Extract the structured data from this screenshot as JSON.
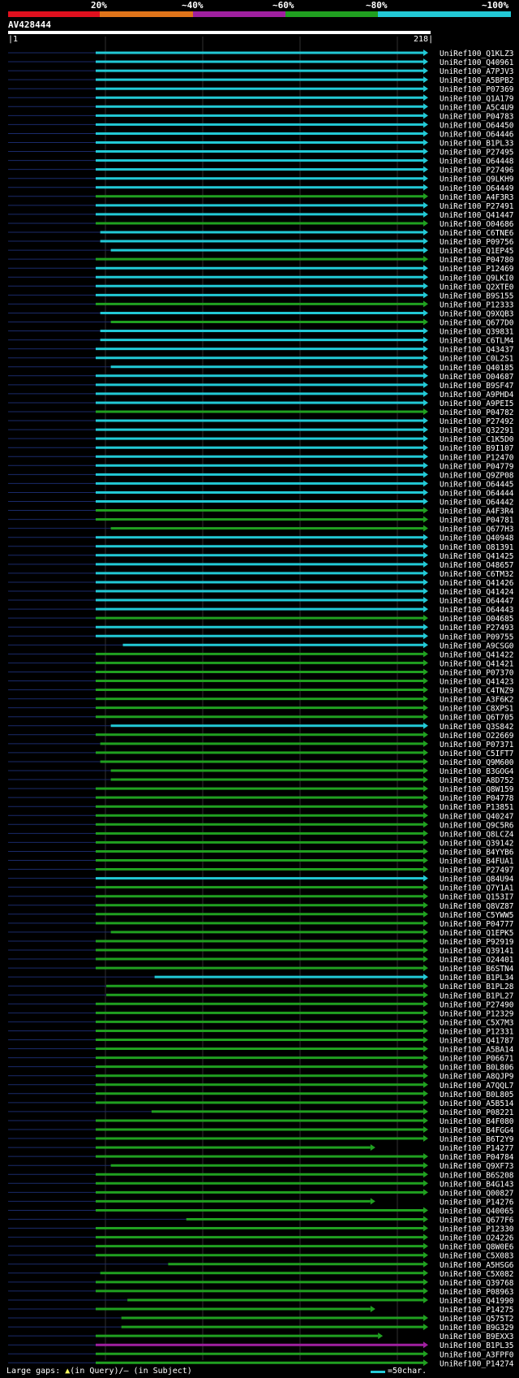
{
  "chart_data": {
    "type": "alignment-overview",
    "query": {
      "name": "AV428444",
      "start_label": "1",
      "end_label": "218",
      "length": 218
    },
    "percent_legend": [
      {
        "label": "20%",
        "color": "#e0101e"
      },
      {
        "label": "~40%",
        "color": "#e0741a"
      },
      {
        "label": "~60%",
        "color": "#a020a0"
      },
      {
        "label": "~80%",
        "color": "#20a020"
      },
      {
        "label": "~100%",
        "color": "#22c9d6"
      }
    ],
    "footer": {
      "large_gaps": "Large gaps: ",
      "in_query": "(in Query)/",
      "in_subject": "– (in Subject)",
      "scale": "=50char."
    },
    "hits": [
      {
        "id": "UniRef100_Q1KLZ3",
        "start": 1,
        "end": 218,
        "identity": "~100%"
      },
      {
        "id": "UniRef100_Q40961",
        "start": 1,
        "end": 218,
        "identity": "~100%"
      },
      {
        "id": "UniRef100_A7PJV3",
        "start": 1,
        "end": 218,
        "identity": "~100%"
      },
      {
        "id": "UniRef100_A5BPB2",
        "start": 1,
        "end": 218,
        "identity": "~100%"
      },
      {
        "id": "UniRef100_P07369",
        "start": 1,
        "end": 218,
        "identity": "~100%"
      },
      {
        "id": "UniRef100_Q1A179",
        "start": 1,
        "end": 218,
        "identity": "~100%"
      },
      {
        "id": "UniRef100_A5C4U9",
        "start": 1,
        "end": 218,
        "identity": "~100%"
      },
      {
        "id": "UniRef100_P04783",
        "start": 1,
        "end": 218,
        "identity": "~100%"
      },
      {
        "id": "UniRef100_O64450",
        "start": 1,
        "end": 218,
        "identity": "~100%"
      },
      {
        "id": "UniRef100_O64446",
        "start": 1,
        "end": 218,
        "identity": "~100%"
      },
      {
        "id": "UniRef100_B1PL33",
        "start": 1,
        "end": 218,
        "identity": "~100%"
      },
      {
        "id": "UniRef100_P27495",
        "start": 1,
        "end": 218,
        "identity": "~100%"
      },
      {
        "id": "UniRef100_O64448",
        "start": 1,
        "end": 218,
        "identity": "~100%"
      },
      {
        "id": "UniRef100_P27496",
        "start": 1,
        "end": 218,
        "identity": "~100%"
      },
      {
        "id": "UniRef100_Q9LKH9",
        "start": 1,
        "end": 218,
        "identity": "~100%"
      },
      {
        "id": "UniRef100_O64449",
        "start": 1,
        "end": 218,
        "identity": "~100%"
      },
      {
        "id": "UniRef100_A4F3R3",
        "start": 1,
        "end": 218,
        "identity": "~80%"
      },
      {
        "id": "UniRef100_P27491",
        "start": 1,
        "end": 218,
        "identity": "~100%"
      },
      {
        "id": "UniRef100_Q41447",
        "start": 1,
        "end": 218,
        "identity": "~100%"
      },
      {
        "id": "UniRef100_O04686",
        "start": 1,
        "end": 218,
        "identity": "~80%"
      },
      {
        "id": "UniRef100_C6TNE6",
        "start": 4,
        "end": 218,
        "identity": "~100%"
      },
      {
        "id": "UniRef100_P09756",
        "start": 4,
        "end": 218,
        "identity": "~100%"
      },
      {
        "id": "UniRef100_Q1EP45",
        "start": 11,
        "end": 218,
        "identity": "~100%"
      },
      {
        "id": "UniRef100_P04780",
        "start": 1,
        "end": 218,
        "identity": "~80%"
      },
      {
        "id": "UniRef100_P12469",
        "start": 1,
        "end": 218,
        "identity": "~100%"
      },
      {
        "id": "UniRef100_Q9LKI0",
        "start": 1,
        "end": 218,
        "identity": "~100%"
      },
      {
        "id": "UniRef100_Q2XTE0",
        "start": 1,
        "end": 218,
        "identity": "~100%"
      },
      {
        "id": "UniRef100_B9S155",
        "start": 1,
        "end": 218,
        "identity": "~100%"
      },
      {
        "id": "UniRef100_P12333",
        "start": 1,
        "end": 218,
        "identity": "~80%"
      },
      {
        "id": "UniRef100_Q9XQB3",
        "start": 4,
        "end": 218,
        "identity": "~100%"
      },
      {
        "id": "UniRef100_Q677D0",
        "start": 11,
        "end": 218,
        "identity": "~80%"
      },
      {
        "id": "UniRef100_Q39831",
        "start": 4,
        "end": 218,
        "identity": "~100%"
      },
      {
        "id": "UniRef100_C6TLM4",
        "start": 4,
        "end": 218,
        "identity": "~100%"
      },
      {
        "id": "UniRef100_Q43437",
        "start": 1,
        "end": 218,
        "identity": "~100%"
      },
      {
        "id": "UniRef100_C0L2S1",
        "start": 1,
        "end": 218,
        "identity": "~100%"
      },
      {
        "id": "UniRef100_Q40185",
        "start": 11,
        "end": 218,
        "identity": "~100%"
      },
      {
        "id": "UniRef100_O04687",
        "start": 1,
        "end": 218,
        "identity": "~100%"
      },
      {
        "id": "UniRef100_B9SF47",
        "start": 1,
        "end": 218,
        "identity": "~100%"
      },
      {
        "id": "UniRef100_A9PHD4",
        "start": 1,
        "end": 218,
        "identity": "~100%"
      },
      {
        "id": "UniRef100_A9PEI5",
        "start": 1,
        "end": 218,
        "identity": "~100%"
      },
      {
        "id": "UniRef100_P04782",
        "start": 1,
        "end": 218,
        "identity": "~80%"
      },
      {
        "id": "UniRef100_P27492",
        "start": 1,
        "end": 218,
        "identity": "~100%"
      },
      {
        "id": "UniRef100_Q32291",
        "start": 1,
        "end": 218,
        "identity": "~100%"
      },
      {
        "id": "UniRef100_C1K5D0",
        "start": 1,
        "end": 218,
        "identity": "~100%"
      },
      {
        "id": "UniRef100_B9I107",
        "start": 1,
        "end": 218,
        "identity": "~100%"
      },
      {
        "id": "UniRef100_P12470",
        "start": 1,
        "end": 218,
        "identity": "~100%"
      },
      {
        "id": "UniRef100_P04779",
        "start": 1,
        "end": 218,
        "identity": "~100%"
      },
      {
        "id": "UniRef100_Q9ZP08",
        "start": 1,
        "end": 218,
        "identity": "~100%"
      },
      {
        "id": "UniRef100_O64445",
        "start": 1,
        "end": 218,
        "identity": "~100%"
      },
      {
        "id": "UniRef100_O64444",
        "start": 1,
        "end": 218,
        "identity": "~100%"
      },
      {
        "id": "UniRef100_O64442",
        "start": 1,
        "end": 218,
        "identity": "~100%"
      },
      {
        "id": "UniRef100_A4F3R4",
        "start": 1,
        "end": 218,
        "identity": "~80%"
      },
      {
        "id": "UniRef100_P04781",
        "start": 1,
        "end": 218,
        "identity": "~80%"
      },
      {
        "id": "UniRef100_Q677H3",
        "start": 11,
        "end": 218,
        "identity": "~80%"
      },
      {
        "id": "UniRef100_Q40948",
        "start": 1,
        "end": 218,
        "identity": "~100%"
      },
      {
        "id": "UniRef100_O81391",
        "start": 1,
        "end": 218,
        "identity": "~100%"
      },
      {
        "id": "UniRef100_Q41425",
        "start": 1,
        "end": 218,
        "identity": "~100%"
      },
      {
        "id": "UniRef100_O48657",
        "start": 1,
        "end": 218,
        "identity": "~100%"
      },
      {
        "id": "UniRef100_C6TM32",
        "start": 1,
        "end": 218,
        "identity": "~100%"
      },
      {
        "id": "UniRef100_Q41426",
        "start": 1,
        "end": 218,
        "identity": "~100%"
      },
      {
        "id": "UniRef100_Q41424",
        "start": 1,
        "end": 218,
        "identity": "~100%"
      },
      {
        "id": "UniRef100_O64447",
        "start": 1,
        "end": 218,
        "identity": "~100%"
      },
      {
        "id": "UniRef100_O64443",
        "start": 1,
        "end": 218,
        "identity": "~100%"
      },
      {
        "id": "UniRef100_O04685",
        "start": 1,
        "end": 218,
        "identity": "~80%"
      },
      {
        "id": "UniRef100_P27493",
        "start": 1,
        "end": 218,
        "identity": "~100%"
      },
      {
        "id": "UniRef100_P09755",
        "start": 1,
        "end": 218,
        "identity": "~100%"
      },
      {
        "id": "UniRef100_A9CSG0",
        "start": 19,
        "end": 218,
        "identity": "~100%"
      },
      {
        "id": "UniRef100_Q41422",
        "start": 1,
        "end": 218,
        "identity": "~80%"
      },
      {
        "id": "UniRef100_Q41421",
        "start": 1,
        "end": 218,
        "identity": "~80%"
      },
      {
        "id": "UniRef100_P07370",
        "start": 1,
        "end": 218,
        "identity": "~80%"
      },
      {
        "id": "UniRef100_Q41423",
        "start": 1,
        "end": 218,
        "identity": "~80%"
      },
      {
        "id": "UniRef100_C4TNZ9",
        "start": 1,
        "end": 218,
        "identity": "~80%"
      },
      {
        "id": "UniRef100_A3F6K2",
        "start": 1,
        "end": 218,
        "identity": "~80%"
      },
      {
        "id": "UniRef100_C8XPS1",
        "start": 1,
        "end": 218,
        "identity": "~80%"
      },
      {
        "id": "UniRef100_Q6T705",
        "start": 1,
        "end": 218,
        "identity": "~80%"
      },
      {
        "id": "UniRef100_Q3S842",
        "start": 11,
        "end": 218,
        "identity": "~100%"
      },
      {
        "id": "UniRef100_O22669",
        "start": 1,
        "end": 218,
        "identity": "~80%"
      },
      {
        "id": "UniRef100_P07371",
        "start": 4,
        "end": 218,
        "identity": "~80%"
      },
      {
        "id": "UniRef100_C5IFT7",
        "start": 1,
        "end": 218,
        "identity": "~80%"
      },
      {
        "id": "UniRef100_Q9M600",
        "start": 4,
        "end": 218,
        "identity": "~80%"
      },
      {
        "id": "UniRef100_B3GOG4",
        "start": 11,
        "end": 218,
        "identity": "~80%"
      },
      {
        "id": "UniRef100_A8D752",
        "start": 11,
        "end": 218,
        "identity": "~80%"
      },
      {
        "id": "UniRef100_Q8W159",
        "start": 1,
        "end": 218,
        "identity": "~80%"
      },
      {
        "id": "UniRef100_P04778",
        "start": 1,
        "end": 218,
        "identity": "~80%"
      },
      {
        "id": "UniRef100_P13851",
        "start": 1,
        "end": 218,
        "identity": "~80%"
      },
      {
        "id": "UniRef100_Q40247",
        "start": 1,
        "end": 218,
        "identity": "~80%"
      },
      {
        "id": "UniRef100_Q9C5R6",
        "start": 1,
        "end": 218,
        "identity": "~80%"
      },
      {
        "id": "UniRef100_Q8LCZ4",
        "start": 1,
        "end": 218,
        "identity": "~80%"
      },
      {
        "id": "UniRef100_Q39142",
        "start": 1,
        "end": 218,
        "identity": "~80%"
      },
      {
        "id": "UniRef100_B4YYB6",
        "start": 1,
        "end": 218,
        "identity": "~80%"
      },
      {
        "id": "UniRef100_B4FUA1",
        "start": 1,
        "end": 218,
        "identity": "~80%"
      },
      {
        "id": "UniRef100_P27497",
        "start": 1,
        "end": 218,
        "identity": "~80%"
      },
      {
        "id": "UniRef100_Q84U94",
        "start": 1,
        "end": 218,
        "identity": "~100%"
      },
      {
        "id": "UniRef100_Q7Y1A1",
        "start": 1,
        "end": 218,
        "identity": "~80%"
      },
      {
        "id": "UniRef100_Q153I7",
        "start": 1,
        "end": 218,
        "identity": "~80%"
      },
      {
        "id": "UniRef100_Q8VZ87",
        "start": 1,
        "end": 218,
        "identity": "~80%"
      },
      {
        "id": "UniRef100_C5YWW5",
        "start": 1,
        "end": 218,
        "identity": "~80%"
      },
      {
        "id": "UniRef100_P04777",
        "start": 1,
        "end": 218,
        "identity": "~80%"
      },
      {
        "id": "UniRef100_Q1EPK5",
        "start": 11,
        "end": 218,
        "identity": "~80%"
      },
      {
        "id": "UniRef100_P92919",
        "start": 1,
        "end": 218,
        "identity": "~80%"
      },
      {
        "id": "UniRef100_Q39141",
        "start": 1,
        "end": 218,
        "identity": "~80%"
      },
      {
        "id": "UniRef100_O24401",
        "start": 1,
        "end": 218,
        "identity": "~80%"
      },
      {
        "id": "UniRef100_B6STN4",
        "start": 1,
        "end": 218,
        "identity": "~80%"
      },
      {
        "id": "UniRef100_B1PL34",
        "start": 40,
        "end": 218,
        "identity": "~100%"
      },
      {
        "id": "UniRef100_B1PL28",
        "start": 8,
        "end": 218,
        "identity": "~80%"
      },
      {
        "id": "UniRef100_B1PL27",
        "start": 8,
        "end": 218,
        "identity": "~80%"
      },
      {
        "id": "UniRef100_P27490",
        "start": 1,
        "end": 218,
        "identity": "~80%"
      },
      {
        "id": "UniRef100_P12329",
        "start": 1,
        "end": 218,
        "identity": "~80%"
      },
      {
        "id": "UniRef100_C5X7M3",
        "start": 1,
        "end": 218,
        "identity": "~80%"
      },
      {
        "id": "UniRef100_P12331",
        "start": 1,
        "end": 218,
        "identity": "~80%"
      },
      {
        "id": "UniRef100_Q41787",
        "start": 1,
        "end": 218,
        "identity": "~80%"
      },
      {
        "id": "UniRef100_A5BA14",
        "start": 1,
        "end": 218,
        "identity": "~80%"
      },
      {
        "id": "UniRef100_P06671",
        "start": 1,
        "end": 218,
        "identity": "~80%"
      },
      {
        "id": "UniRef100_B0L806",
        "start": 1,
        "end": 218,
        "identity": "~80%"
      },
      {
        "id": "UniRef100_A8QJP9",
        "start": 1,
        "end": 218,
        "identity": "~80%"
      },
      {
        "id": "UniRef100_A7QQL7",
        "start": 1,
        "end": 218,
        "identity": "~80%"
      },
      {
        "id": "UniRef100_B0L805",
        "start": 1,
        "end": 218,
        "identity": "~80%"
      },
      {
        "id": "UniRef100_A5B514",
        "start": 1,
        "end": 218,
        "identity": "~80%"
      },
      {
        "id": "UniRef100_P08221",
        "start": 38,
        "end": 218,
        "identity": "~80%"
      },
      {
        "id": "UniRef100_B4F080",
        "start": 1,
        "end": 218,
        "identity": "~80%"
      },
      {
        "id": "UniRef100_B4FGG4",
        "start": 1,
        "end": 218,
        "identity": "~80%"
      },
      {
        "id": "UniRef100_B6T2Y9",
        "start": 1,
        "end": 218,
        "identity": "~80%"
      },
      {
        "id": "UniRef100_P14277",
        "start": 1,
        "end": 183,
        "identity": "~80%"
      },
      {
        "id": "UniRef100_P04784",
        "start": 1,
        "end": 218,
        "identity": "~80%"
      },
      {
        "id": "UniRef100_Q9XF73",
        "start": 11,
        "end": 218,
        "identity": "~80%"
      },
      {
        "id": "UniRef100_B6S208",
        "start": 1,
        "end": 218,
        "identity": "~80%"
      },
      {
        "id": "UniRef100_B4G143",
        "start": 1,
        "end": 218,
        "identity": "~80%"
      },
      {
        "id": "UniRef100_Q00827",
        "start": 1,
        "end": 218,
        "identity": "~80%"
      },
      {
        "id": "UniRef100_P14276",
        "start": 1,
        "end": 183,
        "identity": "~80%"
      },
      {
        "id": "UniRef100_Q40065",
        "start": 1,
        "end": 218,
        "identity": "~80%"
      },
      {
        "id": "UniRef100_Q677F6",
        "start": 61,
        "end": 218,
        "identity": "~80%"
      },
      {
        "id": "UniRef100_P12330",
        "start": 1,
        "end": 218,
        "identity": "~80%"
      },
      {
        "id": "UniRef100_O24226",
        "start": 1,
        "end": 218,
        "identity": "~80%"
      },
      {
        "id": "UniRef100_Q8W0E6",
        "start": 1,
        "end": 218,
        "identity": "~80%"
      },
      {
        "id": "UniRef100_C5X083",
        "start": 1,
        "end": 218,
        "identity": "~80%"
      },
      {
        "id": "UniRef100_A5HSG6",
        "start": 49,
        "end": 218,
        "identity": "~80%"
      },
      {
        "id": "UniRef100_C5X082",
        "start": 4,
        "end": 218,
        "identity": "~80%"
      },
      {
        "id": "UniRef100_Q39768",
        "start": 1,
        "end": 218,
        "identity": "~80%"
      },
      {
        "id": "UniRef100_P08963",
        "start": 1,
        "end": 218,
        "identity": "~80%"
      },
      {
        "id": "UniRef100_Q41990",
        "start": 22,
        "end": 218,
        "identity": "~80%"
      },
      {
        "id": "UniRef100_P14275",
        "start": 1,
        "end": 183,
        "identity": "~80%"
      },
      {
        "id": "UniRef100_Q575T2",
        "start": 18,
        "end": 218,
        "identity": "~80%"
      },
      {
        "id": "UniRef100_B9G329",
        "start": 18,
        "end": 218,
        "identity": "~80%"
      },
      {
        "id": "UniRef100_B9EXX3",
        "start": 1,
        "end": 188,
        "identity": "~80%"
      },
      {
        "id": "UniRef100_B1PL35",
        "start": 1,
        "end": 218,
        "identity": "~60%"
      },
      {
        "id": "UniRef100_A3FPF0",
        "start": 1,
        "end": 218,
        "identity": "~80%"
      },
      {
        "id": "UniRef100_P14274",
        "start": 1,
        "end": 218,
        "identity": "~80%"
      }
    ]
  }
}
